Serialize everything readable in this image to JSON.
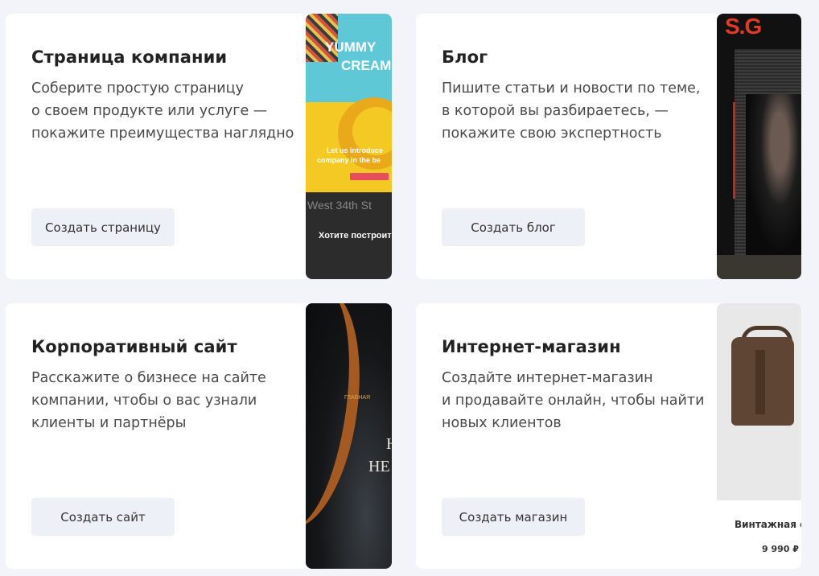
{
  "cards": [
    {
      "title": "Страница компании",
      "description": [
        "Соберите простую страницу",
        "о своем продукте или услуге —",
        "покажите преимущества наглядно"
      ],
      "button": "Создать страницу",
      "preview": {
        "texts": [
          "YUMMY",
          "CREAM",
          "Let us introduce",
          "company in the be",
          "West 34th St",
          "Хотите построить"
        ]
      }
    },
    {
      "title": "Блог",
      "description": [
        "Пишите статьи и новости по теме,",
        "в которой вы разбираетесь, —",
        "покажите свою экспертность"
      ],
      "button": "Создать блог",
      "preview": {
        "texts": [
          "S.G"
        ]
      }
    },
    {
      "title": "Корпоративный сайт",
      "description": [
        "Расскажите о бизнесе на сайте",
        "компании, чтобы о вас узнали",
        "клиенты и партнёры"
      ],
      "button": "Создать сайт",
      "preview": {
        "texts": [
          "ГЛАВНАЯ",
          "H",
          "НЕ"
        ]
      }
    },
    {
      "title": "Интернет-магазин",
      "description": [
        "Создайте интернет-магазин",
        "и продавайте онлайн, чтобы найти",
        "новых клиентов"
      ],
      "button": "Создать магазин",
      "preview": {
        "product_name": "Винтажная су",
        "price": "9 990 ₽"
      }
    }
  ]
}
